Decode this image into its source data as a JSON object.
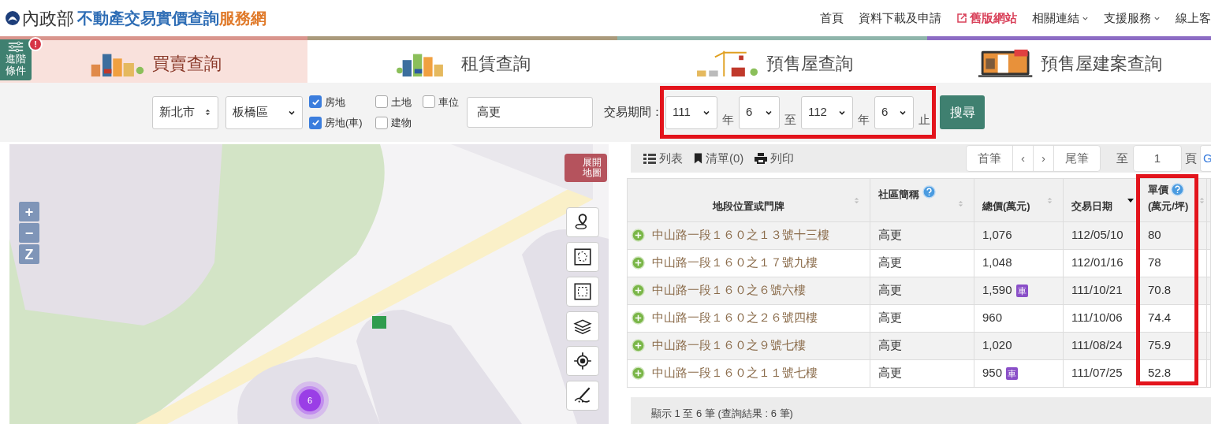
{
  "header": {
    "ministry": "內政部",
    "title": "不動產交易實價查詢",
    "title_suffix": "服務網",
    "nav": [
      {
        "label": "首頁",
        "kind": "link"
      },
      {
        "label": "資料下載及申請",
        "kind": "link"
      },
      {
        "label": "舊版網站",
        "kind": "external"
      },
      {
        "label": "相關連結",
        "kind": "dropdown"
      },
      {
        "label": "支援服務",
        "kind": "dropdown"
      },
      {
        "label": "線上客",
        "kind": "link"
      }
    ]
  },
  "advanced_button": {
    "label": "進階條件",
    "alert": "!"
  },
  "tabs": [
    {
      "label": "買賣查詢",
      "selected": true,
      "color": "#d9958d"
    },
    {
      "label": "租賃查詢",
      "selected": false,
      "color": "#aa9a7c"
    },
    {
      "label": "預售屋查詢",
      "selected": false,
      "color": "#8fb5ab"
    },
    {
      "label": "預售屋建案查詢",
      "selected": false,
      "color": "#8c6cc4"
    }
  ],
  "filters": {
    "city": "新北市",
    "district": "板橋區",
    "checkboxes": [
      {
        "label": "房地",
        "checked": true
      },
      {
        "label": "土地",
        "checked": false
      },
      {
        "label": "車位",
        "checked": false
      },
      {
        "label": "房地(車)",
        "checked": true
      },
      {
        "label": "建物",
        "checked": false
      }
    ],
    "keyword": "高更",
    "period_label": "交易期間：",
    "highlighted": true,
    "period": [
      {
        "kind": "select",
        "value": "111"
      },
      {
        "kind": "text",
        "value": "年"
      },
      {
        "kind": "select",
        "value": "6"
      },
      {
        "kind": "text",
        "value": "至"
      },
      {
        "kind": "select",
        "value": "112"
      },
      {
        "kind": "text",
        "value": "年"
      },
      {
        "kind": "select",
        "value": "6"
      },
      {
        "kind": "text",
        "value": "止"
      }
    ],
    "search_button": "搜尋"
  },
  "map": {
    "expand_button": "展開地圖",
    "zoom_in": "+",
    "zoom_out": "−",
    "zoom_reset": "Z",
    "cluster": "6"
  },
  "toolbar": {
    "actions": [
      {
        "label": "列表",
        "kind": "list"
      },
      {
        "label": "清單(0)",
        "kind": "bookmark"
      },
      {
        "label": "列印",
        "kind": "print"
      }
    ],
    "pager": [
      "首筆",
      "‹",
      "›",
      "尾筆"
    ],
    "goto_label": "至",
    "page": "1",
    "page_unit": "頁",
    "go": "G"
  },
  "table": {
    "columns": [
      {
        "label": "地段位置或門牌",
        "help": false,
        "sorted": false
      },
      {
        "label": "社區簡稱",
        "help": true,
        "sorted": false
      },
      {
        "label": "總價(萬元)",
        "help": false,
        "sorted": false
      },
      {
        "label": "交易日期",
        "help": false,
        "sorted": true
      },
      {
        "label": "單價",
        "sublabel": "(萬元/坪)",
        "help": true,
        "sorted": false,
        "highlighted": true
      }
    ],
    "rows": [
      {
        "address": "中山路一段１６０之１３號十三樓",
        "community": "高更",
        "total": "1,076",
        "date": "112/05/10",
        "unit_price": "80"
      },
      {
        "address": "中山路一段１６０之１７號九樓",
        "community": "高更",
        "total": "1,048",
        "date": "112/01/16",
        "unit_price": "78"
      },
      {
        "address": "中山路一段１６０之６號六樓",
        "community": "高更",
        "total": "1,590",
        "parking": "車",
        "date": "111/10/21",
        "unit_price": "70.8"
      },
      {
        "address": "中山路一段１６０之２６號四樓",
        "community": "高更",
        "total": "960",
        "date": "111/10/06",
        "unit_price": "74.4"
      },
      {
        "address": "中山路一段１６０之９號七樓",
        "community": "高更",
        "total": "1,020",
        "date": "111/08/24",
        "unit_price": "75.9"
      },
      {
        "address": "中山路一段１６０之１１號七樓",
        "community": "高更",
        "total": "950",
        "parking": "車",
        "date": "111/07/25",
        "unit_price": "52.8"
      }
    ],
    "summary": "顯示 1 至 6 筆 (查詢結果 : 6 筆)"
  }
}
